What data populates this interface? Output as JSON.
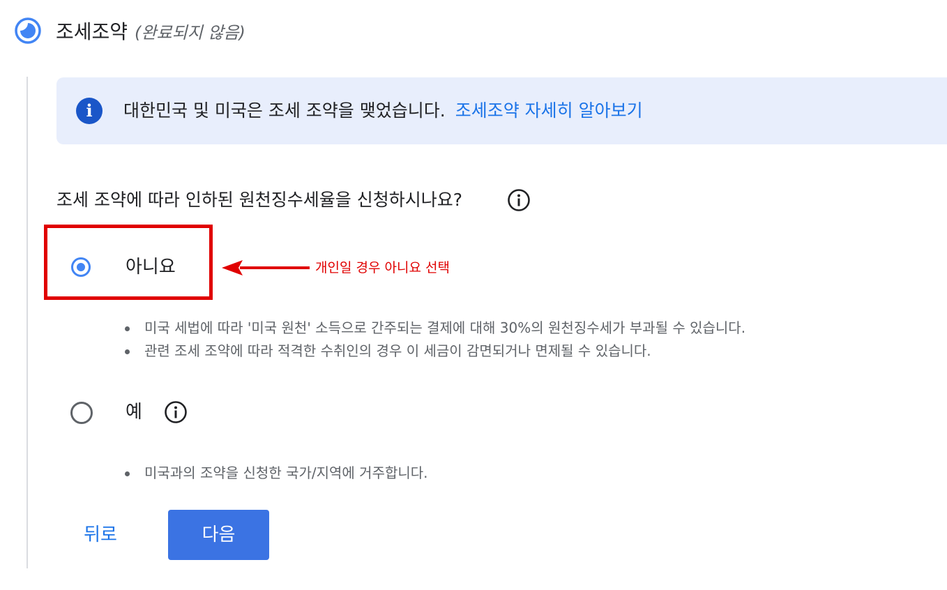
{
  "section": {
    "title": "조세조약",
    "status": "(완료되지 않음)"
  },
  "info_banner": {
    "icon": "info-icon",
    "text": "대한민국 및 미국은 조세 조약을 맺었습니다.",
    "link": "조세조약 자세히 알아보기"
  },
  "question": {
    "text": "조세 조약에 따라 인하된 원천징수세율을 신청하시나요?",
    "help_icon": "help-info-icon"
  },
  "options": [
    {
      "label": "아니요",
      "selected": true,
      "bullets": [
        "미국 세법에 따라 '미국 원천' 소득으로 간주되는 결제에 대해 30%의 원천징수세가 부과될 수 있습니다.",
        "관련 조세 조약에 따라 적격한 수취인의 경우 이 세금이 감면되거나 면제될 수 있습니다."
      ]
    },
    {
      "label": "예",
      "selected": false,
      "bullets": [
        "미국과의 조약을 신청한 국가/지역에 거주합니다."
      ]
    }
  ],
  "annotation": {
    "text": "개인일 경우 아니요 선택",
    "color": "#e00000"
  },
  "buttons": {
    "back": "뒤로",
    "next": "다음"
  },
  "colors": {
    "accent": "#1a73e8",
    "primary_button": "#3b73e3",
    "banner_bg": "#e8eefc",
    "annotation_red": "#e00000"
  }
}
